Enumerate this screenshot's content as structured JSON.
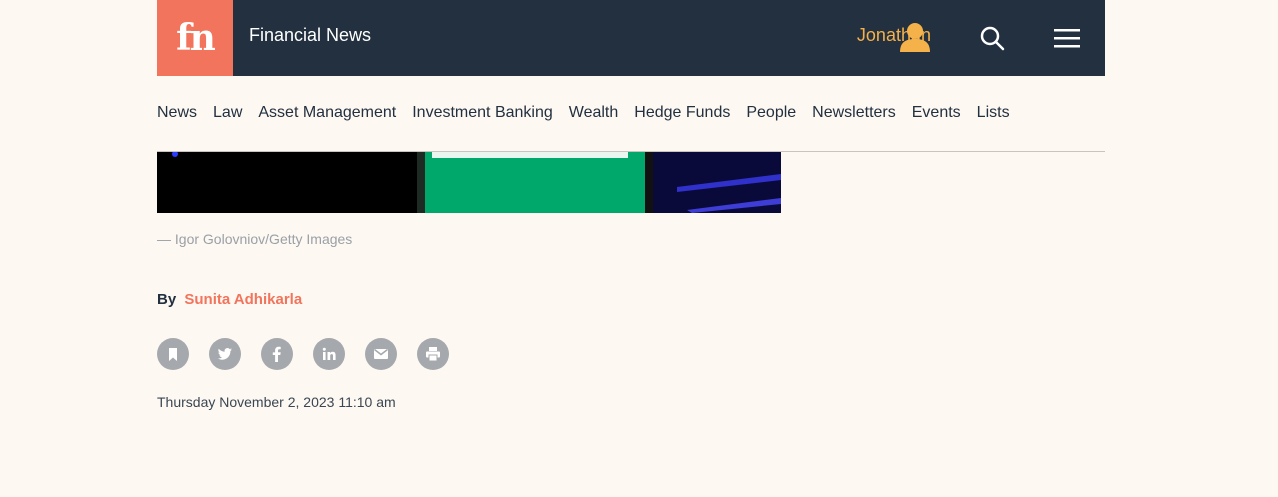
{
  "header": {
    "logo_text": "fn",
    "site_title": "Financial News",
    "user_name": "Jonathan",
    "icons": [
      "user-icon",
      "search-icon",
      "menu-icon"
    ]
  },
  "nav": {
    "items": [
      "News",
      "Law",
      "Asset Management",
      "Investment Banking",
      "Wealth",
      "Hedge Funds",
      "People",
      "Newsletters",
      "Events",
      "Lists"
    ]
  },
  "article": {
    "image_caption": "— Igor Golovniov/Getty Images",
    "byline_prefix": "By",
    "author": "Sunita Adhikarla",
    "timestamp": "Thursday November 2, 2023 11:10 am"
  },
  "share_icons": [
    "bookmark-icon",
    "twitter-icon",
    "facebook-icon",
    "linkedin-icon",
    "email-icon",
    "print-icon"
  ],
  "colors": {
    "header_bg": "#22303f",
    "logo_bg": "#f2745c",
    "accent_user": "#f5b14a",
    "author": "#f2745c",
    "page_bg": "#fdf8f2",
    "share_icon_bg": "#a5a9ad"
  }
}
